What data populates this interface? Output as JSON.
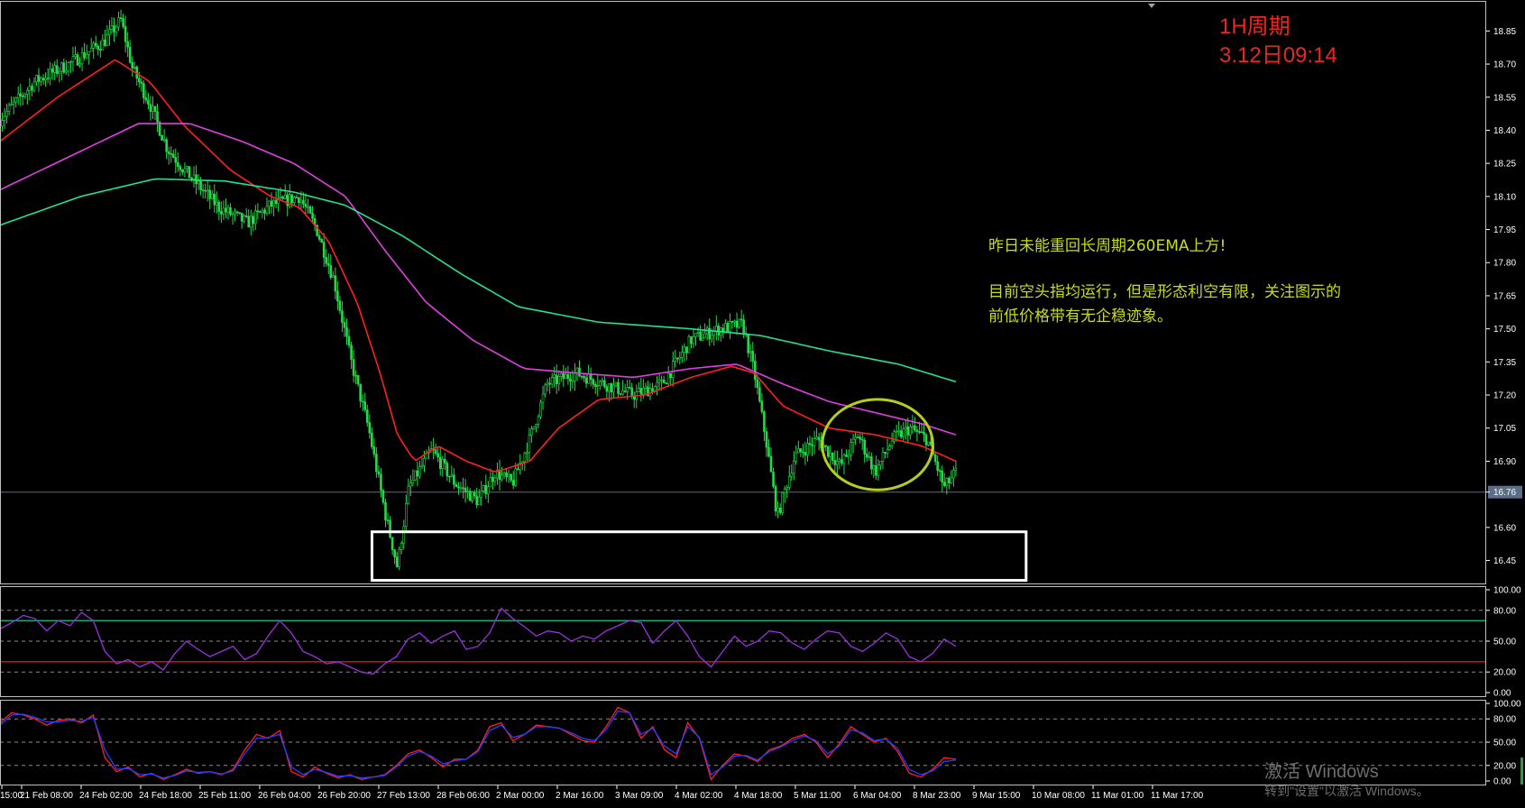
{
  "chart_data": [
    {
      "type": "candlestick",
      "panel": "price",
      "ylim": [
        16.35,
        18.97
      ],
      "y_ticks": [
        "18.85",
        "18.70",
        "18.55",
        "18.40",
        "18.25",
        "18.10",
        "17.95",
        "17.80",
        "17.65",
        "17.50",
        "17.35",
        "17.20",
        "17.05",
        "16.90",
        "16.76",
        "16.60",
        "16.45"
      ],
      "x_ticks": [
        "15:00",
        "21 Feb 08:00",
        "24 Feb 02:00",
        "24 Feb 18:00",
        "25 Feb 11:00",
        "26 Feb 04:00",
        "26 Feb 20:00",
        "27 Feb 13:00",
        "28 Feb 06:00",
        "2 Mar 00:00",
        "2 Mar 16:00",
        "3 Mar 09:00",
        "4 Mar 02:00",
        "4 Mar 18:00",
        "5 Mar 11:00",
        "6 Mar 04:00",
        "8 Mar 23:00",
        "9 Mar 15:00",
        "10 Mar 08:00",
        "11 Mar 01:00",
        "11 Mar 17:00"
      ],
      "current_price": 16.76,
      "price_path": [
        [
          0,
          18.45
        ],
        [
          0.03,
          18.62
        ],
        [
          0.06,
          18.7
        ],
        [
          0.09,
          18.8
        ],
        [
          0.105,
          18.9
        ],
        [
          0.115,
          18.68
        ],
        [
          0.13,
          18.52
        ],
        [
          0.145,
          18.32
        ],
        [
          0.16,
          18.22
        ],
        [
          0.19,
          18.05
        ],
        [
          0.215,
          17.98
        ],
        [
          0.235,
          18.06
        ],
        [
          0.26,
          18.1
        ],
        [
          0.275,
          17.95
        ],
        [
          0.29,
          17.72
        ],
        [
          0.305,
          17.35
        ],
        [
          0.32,
          17.05
        ],
        [
          0.335,
          16.65
        ],
        [
          0.345,
          16.42
        ],
        [
          0.355,
          16.78
        ],
        [
          0.375,
          16.95
        ],
        [
          0.395,
          16.8
        ],
        [
          0.415,
          16.72
        ],
        [
          0.43,
          16.85
        ],
        [
          0.445,
          16.8
        ],
        [
          0.46,
          17.0
        ],
        [
          0.475,
          17.25
        ],
        [
          0.5,
          17.3
        ],
        [
          0.525,
          17.25
        ],
        [
          0.55,
          17.2
        ],
        [
          0.575,
          17.25
        ],
        [
          0.6,
          17.45
        ],
        [
          0.625,
          17.5
        ],
        [
          0.645,
          17.52
        ],
        [
          0.655,
          17.3
        ],
        [
          0.665,
          17.0
        ],
        [
          0.675,
          16.65
        ],
        [
          0.69,
          16.92
        ],
        [
          0.71,
          17.0
        ],
        [
          0.73,
          16.88
        ],
        [
          0.745,
          17.02
        ],
        [
          0.76,
          16.85
        ],
        [
          0.775,
          17.0
        ],
        [
          0.79,
          17.05
        ],
        [
          0.805,
          17.0
        ],
        [
          0.82,
          16.78
        ],
        [
          0.83,
          16.85
        ]
      ],
      "indicators": [
        {
          "name": "EMA-short",
          "color": "#ff2020",
          "path": [
            [
              0,
              18.35
            ],
            [
              0.05,
              18.55
            ],
            [
              0.1,
              18.72
            ],
            [
              0.13,
              18.62
            ],
            [
              0.16,
              18.42
            ],
            [
              0.2,
              18.22
            ],
            [
              0.235,
              18.1
            ],
            [
              0.26,
              18.05
            ],
            [
              0.285,
              17.9
            ],
            [
              0.31,
              17.62
            ],
            [
              0.33,
              17.3
            ],
            [
              0.345,
              17.02
            ],
            [
              0.36,
              16.9
            ],
            [
              0.38,
              16.97
            ],
            [
              0.405,
              16.9
            ],
            [
              0.43,
              16.85
            ],
            [
              0.46,
              16.9
            ],
            [
              0.485,
              17.05
            ],
            [
              0.52,
              17.18
            ],
            [
              0.56,
              17.2
            ],
            [
              0.6,
              17.28
            ],
            [
              0.635,
              17.33
            ],
            [
              0.655,
              17.3
            ],
            [
              0.68,
              17.15
            ],
            [
              0.72,
              17.05
            ],
            [
              0.76,
              17.02
            ],
            [
              0.8,
              16.97
            ],
            [
              0.83,
              16.9
            ]
          ]
        },
        {
          "name": "EMA-mid",
          "color": "#e040e0",
          "path": [
            [
              0,
              18.13
            ],
            [
              0.06,
              18.28
            ],
            [
              0.12,
              18.43
            ],
            [
              0.165,
              18.43
            ],
            [
              0.21,
              18.35
            ],
            [
              0.255,
              18.25
            ],
            [
              0.3,
              18.1
            ],
            [
              0.335,
              17.85
            ],
            [
              0.37,
              17.62
            ],
            [
              0.41,
              17.45
            ],
            [
              0.455,
              17.32
            ],
            [
              0.5,
              17.3
            ],
            [
              0.55,
              17.28
            ],
            [
              0.6,
              17.32
            ],
            [
              0.64,
              17.34
            ],
            [
              0.68,
              17.25
            ],
            [
              0.72,
              17.17
            ],
            [
              0.76,
              17.12
            ],
            [
              0.8,
              17.07
            ],
            [
              0.83,
              17.02
            ]
          ]
        },
        {
          "name": "EMA-260",
          "color": "#26e08c",
          "path": [
            [
              0,
              17.97
            ],
            [
              0.07,
              18.1
            ],
            [
              0.135,
              18.18
            ],
            [
              0.195,
              18.17
            ],
            [
              0.255,
              18.12
            ],
            [
              0.3,
              18.06
            ],
            [
              0.35,
              17.92
            ],
            [
              0.4,
              17.75
            ],
            [
              0.45,
              17.6
            ],
            [
              0.52,
              17.53
            ],
            [
              0.6,
              17.5
            ],
            [
              0.66,
              17.47
            ],
            [
              0.72,
              17.4
            ],
            [
              0.78,
              17.34
            ],
            [
              0.83,
              17.26
            ]
          ]
        }
      ],
      "highlight_box": {
        "x_from": 0.323,
        "x_to": 0.891,
        "y_from": 16.36,
        "y_to": 16.58
      },
      "highlight_ellipse": {
        "center_x": 0.762,
        "center_y": 16.975,
        "radius_x": 0.048,
        "radius_y": 0.205
      }
    },
    {
      "type": "line",
      "panel": "oscillator-1",
      "ylim": [
        0,
        100
      ],
      "y_ticks": [
        "100.00",
        "80.00",
        "50.00",
        "20.00",
        "0.00"
      ],
      "levels": [
        {
          "value": 70,
          "color": "#26e08c"
        },
        {
          "value": 30,
          "color": "#ff2020"
        }
      ],
      "series": [
        {
          "color": "#9b30e0",
          "values": [
            62,
            68,
            75,
            72,
            60,
            70,
            65,
            78,
            70,
            40,
            28,
            32,
            25,
            30,
            22,
            38,
            50,
            42,
            35,
            40,
            45,
            32,
            38,
            55,
            70,
            58,
            40,
            35,
            28,
            30,
            25,
            20,
            18,
            28,
            35,
            52,
            58,
            48,
            55,
            60,
            42,
            45,
            58,
            82,
            72,
            64,
            55,
            60,
            58,
            50,
            55,
            52,
            60,
            65,
            70,
            68,
            48,
            60,
            70,
            55,
            35,
            25,
            40,
            55,
            45,
            50,
            60,
            58,
            48,
            42,
            52,
            60,
            58,
            45,
            40,
            48,
            58,
            52,
            35,
            30,
            38,
            52,
            45
          ]
        }
      ]
    },
    {
      "type": "line",
      "panel": "oscillator-2",
      "ylim": [
        0,
        100
      ],
      "y_ticks": [
        "100.00",
        "80.00",
        "50.00",
        "20.00",
        "0.00"
      ],
      "series": [
        {
          "color": "#ff2020",
          "values": [
            75,
            88,
            85,
            80,
            72,
            78,
            80,
            75,
            85,
            30,
            12,
            18,
            5,
            10,
            2,
            8,
            15,
            10,
            12,
            8,
            15,
            40,
            60,
            55,
            65,
            12,
            5,
            18,
            10,
            4,
            8,
            2,
            5,
            8,
            20,
            35,
            40,
            30,
            18,
            28,
            28,
            40,
            70,
            75,
            52,
            60,
            72,
            70,
            68,
            60,
            52,
            50,
            70,
            95,
            88,
            55,
            70,
            40,
            30,
            75,
            55,
            2,
            20,
            35,
            32,
            25,
            40,
            45,
            55,
            60,
            50,
            30,
            48,
            70,
            60,
            50,
            55,
            38,
            10,
            5,
            15,
            30,
            28
          ]
        },
        {
          "color": "#2a3cff",
          "values": [
            72,
            85,
            86,
            82,
            76,
            76,
            78,
            77,
            82,
            40,
            15,
            16,
            8,
            9,
            4,
            7,
            13,
            11,
            12,
            9,
            13,
            35,
            55,
            56,
            60,
            18,
            8,
            15,
            11,
            6,
            7,
            4,
            5,
            7,
            18,
            32,
            38,
            32,
            22,
            26,
            28,
            38,
            65,
            72,
            56,
            60,
            70,
            70,
            68,
            62,
            55,
            52,
            66,
            90,
            88,
            60,
            68,
            45,
            35,
            70,
            56,
            8,
            18,
            32,
            33,
            27,
            38,
            44,
            52,
            58,
            52,
            35,
            45,
            66,
            62,
            52,
            54,
            42,
            15,
            8,
            13,
            25,
            27
          ]
        }
      ]
    }
  ],
  "annotations": {
    "period_line1": "1H周期",
    "period_line2": "3.12日09:14",
    "note_line1": "昨日未能重回长周期260EMA上方!",
    "note_line2": "目前空头指均运行，但是形态利空有限，关注图示的",
    "note_line3": "前低价格带有无企稳迹象。"
  },
  "watermark": {
    "line1": "激活 Windows",
    "line2": "转到\"设置\"以激活 Windows。"
  },
  "colors": {
    "background": "#000000",
    "candle": "#26d84a",
    "axis": "#ffffff",
    "highlight_box": "#ffffff",
    "highlight_ellipse": "#b8cc1a",
    "note_text": "#c8dc1e",
    "period_text": "#e8281e"
  }
}
